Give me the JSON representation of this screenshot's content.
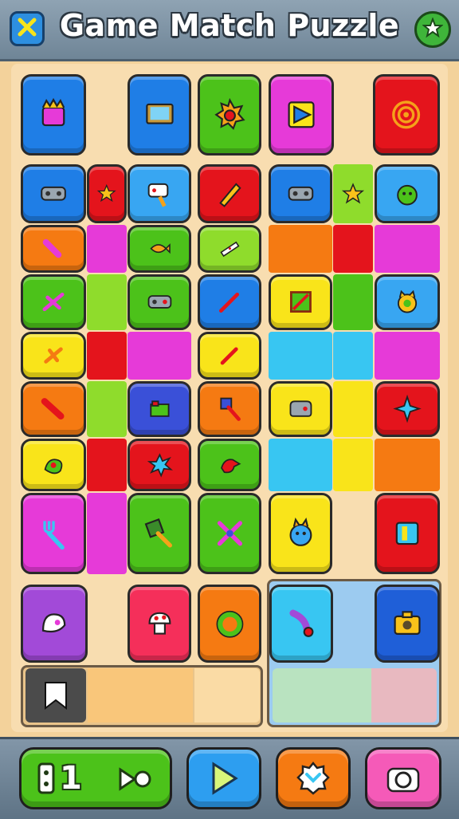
{
  "header": {
    "title": "Game Match Puzzle",
    "close_icon": "close-icon",
    "star_icon": "star-badge-icon"
  },
  "colors": {
    "blue": "#1f7ee6",
    "green": "#4cc21a",
    "lime": "#8fdc2c",
    "magenta": "#e63ad8",
    "red": "#e4141c",
    "orange": "#f57a12",
    "yellow": "#f9e41a",
    "cyan": "#38c6f2",
    "purple": "#a24ad8",
    "pink": "#f52f8a",
    "amber": "#ff9f1a"
  },
  "board": {
    "rows": [
      [
        "crown-device",
        "tablet",
        "flame-orb",
        "play-triangle",
        "red-swirl"
      ],
      [
        "game-controller",
        "star",
        "handheld-controller",
        "pencil",
        "game-controller",
        "star",
        "green-monster"
      ],
      [
        "popsicle",
        "fish",
        "dice-controller"
      ],
      [
        "propeller",
        "game-controller",
        "marker",
        "paintbrush-frame",
        "cat-emblem"
      ],
      [
        "airplane",
        "crayon"
      ],
      [
        "rocket",
        "film-gadget",
        "paddle",
        "gamepad",
        "blue-jet"
      ],
      [
        "green-blob",
        "splat",
        "red-bird"
      ],
      [
        "fork",
        "fly-swatter",
        "crossed-tools",
        "blue-dragon",
        "smartphone"
      ],
      [
        "ghost",
        "mushroom",
        "donut-ring",
        "purple-drop",
        "yellow-camera"
      ]
    ],
    "counter_slots": [
      {
        "label": "",
        "icon": "bookmark-icon"
      },
      {
        "label": "",
        "icon": ""
      },
      {
        "label": "",
        "icon": ""
      }
    ]
  },
  "toolbar": {
    "moves_count": "1",
    "moves_icon": "battery-icon",
    "moves_arrow_icon": "skip-icon",
    "play_icon": "play-icon",
    "hint_icon": "badge-icon",
    "camera_icon": "camera-icon"
  }
}
